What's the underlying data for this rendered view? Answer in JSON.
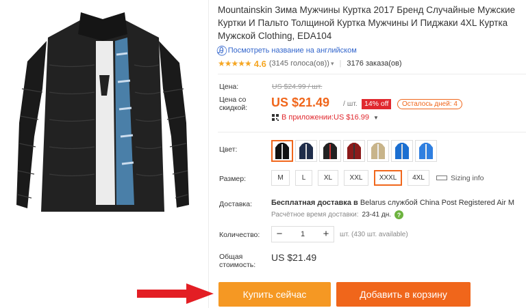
{
  "product": {
    "title": "Mountainskin Зима Мужчины Куртка 2017 Бренд Случайные Мужские Куртки И Пальто Толщиной Куртка Мужчины И Пиджаки 4XL Куртка Мужской Clothing, EDA104",
    "translate_link": "Посмотреть название на английском",
    "rating_score": "4.6",
    "rating_votes": "(3145 голоса(ов))",
    "orders": "3176 заказа(ов)"
  },
  "price": {
    "label_price": "Цена:",
    "original": "US $24.99 / шт.",
    "label_discount_line1": "Цена со",
    "label_discount_line2": "скидкой:",
    "sale": "US $21.49",
    "per_unit": "/ шт.",
    "discount_badge": "14% off",
    "days_left": "Осталось дней: 4",
    "app_price": "В приложении:US $16.99"
  },
  "options": {
    "color_label": "Цвет:",
    "size_label": "Размер:",
    "sizes": [
      "M",
      "L",
      "XL",
      "XXL",
      "XXXL",
      "4XL"
    ],
    "selected_size": "XXXL",
    "sizing_info": "Sizing info"
  },
  "shipping": {
    "label": "Доставка:",
    "free_part": "Бесплатная доставка в",
    "rest": "Belarus службой China Post Registered Air M",
    "time_label": "Расчётное время доставки:",
    "time_value": "23-41 дн."
  },
  "quantity": {
    "label": "Количество:",
    "value": "1",
    "minus": "−",
    "plus": "+",
    "note": "шт. (430 шт. available)"
  },
  "total": {
    "label_line1": "Общая",
    "label_line2": "стоимость:",
    "value": "US $21.49"
  },
  "actions": {
    "buy_now": "Купить сейчас",
    "add_to_cart": "Добавить в корзину"
  },
  "colors": {
    "accent": "#f0661b",
    "buy_button": "#f59823",
    "discount_badge": "#e0282e",
    "link": "#3366cc",
    "star": "#f5a623"
  }
}
